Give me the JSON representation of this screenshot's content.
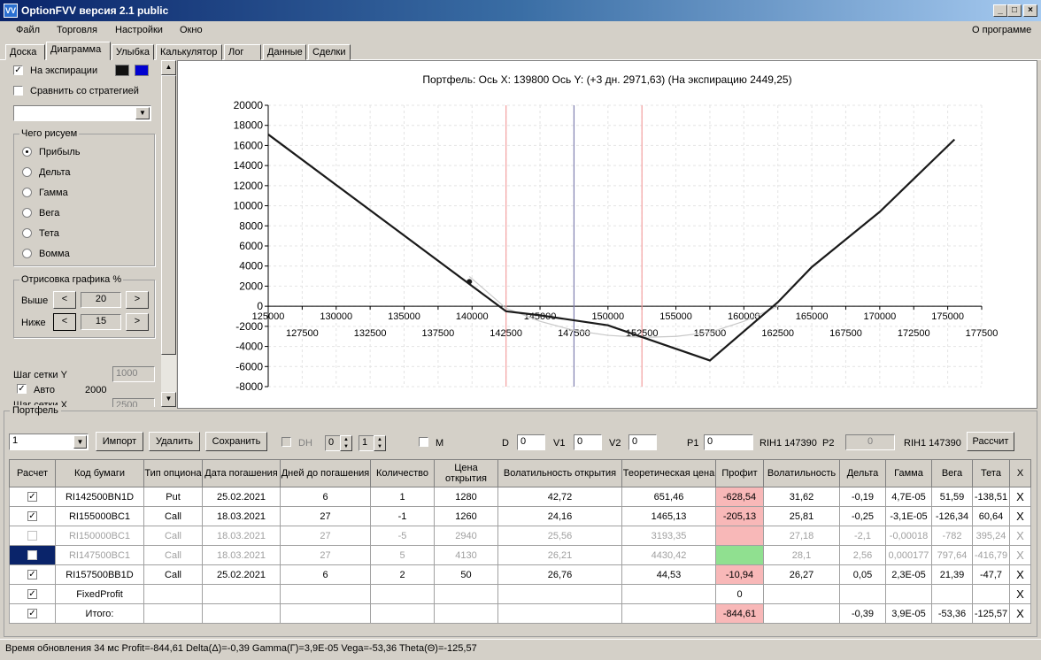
{
  "window": {
    "title": "OptionFVV версия 2.1 public",
    "icon": "app-icon",
    "min": "_",
    "max": "□",
    "close": "×"
  },
  "menu": {
    "items": [
      "Файл",
      "Торговля",
      "Настройки",
      "Окно"
    ],
    "about": "О программе"
  },
  "tabs": [
    "Доска",
    "Диаграмма",
    "Улыбка",
    "Калькулятор",
    "Лог",
    "Данные",
    "Сделки"
  ],
  "active_tab": "Диаграмма",
  "left": {
    "expiry_label": "На экспирации",
    "expiry_checked": true,
    "expiry_colors": [
      "#111111",
      "#0000d0"
    ],
    "compare_label": "Сравнить со стратегией",
    "compare_checked": false,
    "compare_select": "",
    "what_group": "Чего рисуем",
    "radios": [
      "Прибыль",
      "Дельта",
      "Гамма",
      "Вега",
      "Тета",
      "Вомма"
    ],
    "radio_selected": "Прибыль",
    "draw_group": "Отрисовка графика %",
    "above_label": "Выше",
    "above_value": "20",
    "below_label": "Ниже",
    "below_value": "15",
    "left_arrow": "<",
    "right_arrow": ">",
    "grid_y_label": "Шаг сетки Y",
    "grid_y_value": "1000",
    "auto_label": "Авто",
    "auto_checked": true,
    "auto_value": "2000",
    "grid_x_label": "Шаг сетки X",
    "grid_x_value": "2500"
  },
  "chart_header": "Портфель: Ось X:  139800 Ось Y:   (+3 дн.  2971,63)  (На экспирацию 2449,25)",
  "chart_data": {
    "type": "line",
    "xlim": [
      125000,
      177500
    ],
    "ylim": [
      -8000,
      20000
    ],
    "x_ticks_top": [
      125000,
      130000,
      135000,
      140000,
      145000,
      150000,
      155000,
      160000,
      165000,
      170000,
      175000
    ],
    "x_ticks_bottom": [
      127500,
      132500,
      137500,
      142500,
      147500,
      152500,
      157500,
      162500,
      167500,
      172500,
      177500
    ],
    "y_ticks": [
      20000,
      18000,
      16000,
      14000,
      12000,
      10000,
      8000,
      6000,
      4000,
      2000,
      0,
      -2000,
      -4000,
      -6000,
      -8000
    ],
    "vlines": [
      {
        "x": 142500,
        "color": "#f4a0a0"
      },
      {
        "x": 147500,
        "color": "#8080b0"
      },
      {
        "x": 152500,
        "color": "#f4a0a0"
      }
    ],
    "series": [
      {
        "color": "#1a1a1a",
        "x": [
          125000,
          142500,
          145000,
          150000,
          157500,
          162500,
          165000,
          170000,
          175500
        ],
        "y": [
          17100,
          -500,
          -900,
          -1900,
          -5400,
          400,
          3900,
          9400,
          16600
        ]
      },
      {
        "color": "#c8c8c8",
        "x": [
          139800,
          142500,
          145000,
          147500,
          150000,
          152500,
          155000,
          157500,
          160000,
          162500
        ],
        "y": [
          2971,
          -200,
          -1500,
          -2400,
          -2900,
          -3100,
          -3000,
          -2600,
          -1500,
          0
        ]
      }
    ],
    "marker": {
      "x": 139800,
      "y": 2449
    }
  },
  "portfolio": {
    "label": "Портфель",
    "select": "1",
    "import_btn": "Импорт",
    "delete_btn": "Удалить",
    "save_btn": "Сохранить",
    "dh_label": "DH",
    "dh_value1": "0",
    "dh_value2": "1",
    "m_label": "M",
    "d_label": "D",
    "d_value": "0",
    "v1_label": "V1",
    "v1_value": "0",
    "v2_label": "V2",
    "v2_value": "0",
    "p1_label": "P1",
    "p1_value": "0",
    "p1_ticker": "RIH1 147390",
    "p2_label": "P2",
    "p2_value": "0",
    "p2_ticker": "RIH1 147390",
    "calc_btn": "Рассчит",
    "columns": [
      "Расчет",
      "Код бумаги",
      "Тип опциона",
      "Дата погашения",
      "Дней до погашения",
      "Количество",
      "Цена открытия",
      "Волатильность открытия",
      "Теоретическая цена",
      "Профит",
      "Волатильность",
      "Дельта",
      "Гамма",
      "Вега",
      "Тета",
      "X"
    ],
    "rows": [
      {
        "check": "✓",
        "cells": [
          "RI142500BN1D",
          "Put",
          "25.02.2021",
          "6",
          "1",
          "1280",
          "42,72",
          "651,46",
          "-628,54",
          "31,62",
          "-0,19",
          "4,7E-05",
          "51,59",
          "-138,51"
        ],
        "dim": false,
        "profit_class": "neg",
        "selected": false
      },
      {
        "check": "✓",
        "cells": [
          "RI155000BC1",
          "Call",
          "18.03.2021",
          "27",
          "-1",
          "1260",
          "24,16",
          "1465,13",
          "-205,13",
          "25,81",
          "-0,25",
          "-3,1E-05",
          "-126,34",
          "60,64"
        ],
        "dim": false,
        "profit_class": "neg",
        "selected": false
      },
      {
        "check": "",
        "cells": [
          "RI150000BC1",
          "Call",
          "18.03.2021",
          "27",
          "-5",
          "2940",
          "25,56",
          "3193,35",
          "",
          "27,18",
          "-2,1",
          "-0,00018",
          "-782",
          "395,24"
        ],
        "dim": true,
        "profit_class": "neg",
        "selected": false
      },
      {
        "check": "",
        "cells": [
          "RI147500BC1",
          "Call",
          "18.03.2021",
          "27",
          "5",
          "4130",
          "26,21",
          "4430,42",
          "",
          "28,1",
          "2,56",
          "0,000177",
          "797,64",
          "-416,79"
        ],
        "dim": true,
        "profit_class": "pos",
        "selected": true
      },
      {
        "check": "✓",
        "cells": [
          "RI157500BB1D",
          "Call",
          "25.02.2021",
          "6",
          "2",
          "50",
          "26,76",
          "44,53",
          "-10,94",
          "26,27",
          "0,05",
          "2,3E-05",
          "21,39",
          "-47,7"
        ],
        "dim": false,
        "profit_class": "neg",
        "selected": false
      },
      {
        "check": "✓",
        "cells": [
          "FixedProfit",
          "",
          "",
          "",
          "",
          "",
          "",
          "",
          "0",
          "",
          "",
          "",
          "",
          ""
        ],
        "dim": false,
        "profit_class": "",
        "selected": false
      },
      {
        "check": "✓",
        "cells": [
          "Итого:",
          "",
          "",
          "",
          "",
          "",
          "",
          "",
          "-844,61",
          "",
          "-0,39",
          "3,9E-05",
          "-53,36",
          "-125,57"
        ],
        "dim": false,
        "profit_class": "neg",
        "selected": false
      }
    ]
  },
  "status": "Время обновления 34 мс  Profit=-844,61 Delta(Δ)=-0,39 Gamma(Γ)=3,9E-05 Vega=-53,36 Theta(Θ)=-125,57"
}
